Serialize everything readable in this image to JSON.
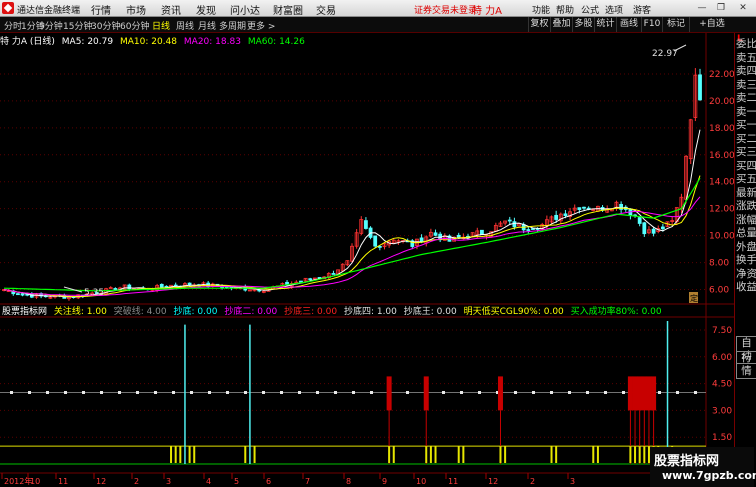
{
  "app": {
    "brand": "通达信金融终端"
  },
  "menu": [
    "行情",
    "市场",
    "资讯",
    "发现",
    "问小达",
    "财富圈",
    "交易"
  ],
  "warning": "证券交易未登录",
  "stock_title": "特 力A",
  "menu_right": [
    "功能",
    "帮助",
    "公式",
    "选项",
    "游客"
  ],
  "periods": [
    {
      "label": "分时",
      "active": false
    },
    {
      "label": "1分钟",
      "active": false
    },
    {
      "label": "5分钟",
      "active": false
    },
    {
      "label": "15分钟",
      "active": false
    },
    {
      "label": "30分钟",
      "active": false
    },
    {
      "label": "60分钟",
      "active": false
    },
    {
      "label": "日线",
      "active": true
    },
    {
      "label": "周线",
      "active": false
    },
    {
      "label": "月线",
      "active": false
    },
    {
      "label": "多周期",
      "active": false
    },
    {
      "label": "更多 >",
      "active": false
    }
  ],
  "toolbar_right": [
    "复权",
    "叠加",
    "多股",
    "统计",
    "画线",
    "F10",
    "标记",
    "+自选"
  ],
  "info": {
    "name": "特 力A (日线)",
    "ma": [
      {
        "label": "MA5: 20.79",
        "color": "#ffffff"
      },
      {
        "label": "MA10: 20.48",
        "color": "#ffff00"
      },
      {
        "label": "MA20: 18.83",
        "color": "#ff00ff"
      },
      {
        "label": "MA60: 14.26",
        "color": "#00ff00"
      }
    ]
  },
  "indicator": {
    "name": "股票指标网",
    "items": [
      {
        "label": "关注线: 1.00",
        "color": "#ffff00"
      },
      {
        "label": "突破线: 4.00",
        "color": "#888888"
      },
      {
        "label": "抄底: 0.00",
        "color": "#00ffff"
      },
      {
        "label": "抄底二: 0.00",
        "color": "#ff00ff"
      },
      {
        "label": "抄底三: 0.00",
        "color": "#ff2020"
      },
      {
        "label": "抄底四: 1.00",
        "color": "#e0e0e0"
      },
      {
        "label": "抄底王: 0.00",
        "color": "#e0e0e0"
      },
      {
        "label": "明天低买CGL90%: 0.00",
        "color": "#ffff00"
      },
      {
        "label": "买入成功率80%: 0.00",
        "color": "#00ff00"
      }
    ]
  },
  "right_panel": [
    "委比",
    "卖五",
    "卖四",
    "卖三",
    "卖二",
    "卖一",
    "买一",
    "买二",
    "买三",
    "买四",
    "买五",
    "最新",
    "涨跌",
    "涨幅",
    "总量",
    "外盘",
    "换手",
    "净资",
    "收益",
    "自动",
    "行情"
  ],
  "price_axis": [
    "22.00",
    "20.00",
    "18.00",
    "16.00",
    "14.00",
    "12.00",
    "10.00",
    "8.00",
    "6.00"
  ],
  "ind_axis": [
    "7.50",
    "6.00",
    "4.50",
    "3.00",
    "1.50"
  ],
  "date_axis": [
    "2012年",
    "10",
    "11",
    "12",
    "2",
    "3",
    "4",
    "5",
    "6",
    "7",
    "8",
    "9",
    "10",
    "11",
    "12",
    "2",
    "3"
  ],
  "high_label": "22.97",
  "low_label": "5.35",
  "ding_label": "定",
  "watermark": {
    "line1": "股票指标网",
    "line2": "www.7gpzb.com"
  },
  "colors": {
    "ma5": "#ffffff",
    "ma10": "#ffff00",
    "ma20": "#ff00ff",
    "ma60": "#00ff00",
    "up": "#ff3232",
    "down": "#54ffff"
  },
  "chart_data": {
    "type": "candlestick",
    "title": "特 力A (日线)",
    "ylim": [
      5,
      24
    ],
    "close_trend": [
      [
        0,
        6.0
      ],
      [
        4,
        5.6
      ],
      [
        8,
        5.5
      ],
      [
        14,
        5.45
      ],
      [
        20,
        5.8
      ],
      [
        26,
        6.2
      ],
      [
        30,
        6.0
      ],
      [
        36,
        6.3
      ],
      [
        42,
        6.4
      ],
      [
        50,
        6.1
      ],
      [
        56,
        6.0
      ],
      [
        60,
        6.3
      ],
      [
        66,
        6.8
      ],
      [
        70,
        7.1
      ],
      [
        74,
        8.0
      ],
      [
        77,
        11.0
      ],
      [
        80,
        9.2
      ],
      [
        84,
        9.8
      ],
      [
        88,
        9.3
      ],
      [
        92,
        10.2
      ],
      [
        96,
        9.6
      ],
      [
        100,
        10.0
      ],
      [
        104,
        10.3
      ],
      [
        108,
        11.0
      ],
      [
        112,
        10.6
      ],
      [
        116,
        10.8
      ],
      [
        120,
        11.6
      ],
      [
        124,
        12.2
      ],
      [
        128,
        12.0
      ],
      [
        132,
        12.4
      ],
      [
        134,
        12.0
      ],
      [
        136,
        11.5
      ],
      [
        138,
        10.4
      ],
      [
        140,
        10.2
      ],
      [
        142,
        10.6
      ],
      [
        144,
        11.0
      ],
      [
        146,
        13.0
      ],
      [
        147,
        16.0
      ],
      [
        148,
        19.0
      ],
      [
        149,
        21.5
      ],
      [
        150,
        20.5
      ]
    ],
    "ma60_trend": [
      [
        0,
        6.1
      ],
      [
        20,
        5.9
      ],
      [
        40,
        6.1
      ],
      [
        56,
        6.1
      ],
      [
        66,
        6.6
      ],
      [
        76,
        7.4
      ],
      [
        90,
        8.6
      ],
      [
        104,
        9.5
      ],
      [
        120,
        10.6
      ],
      [
        132,
        11.6
      ],
      [
        140,
        11.3
      ],
      [
        146,
        12.0
      ],
      [
        150,
        14.26
      ]
    ],
    "ind_axis_ylim": [
      0,
      8
    ],
    "cyan_spikes": [
      {
        "bar": 39,
        "value": 7.8
      },
      {
        "bar": 53,
        "value": 7.8
      },
      {
        "bar": 143,
        "value": 8.0
      }
    ],
    "red_block_bars": [
      83,
      91,
      107,
      135,
      136,
      137,
      138,
      139,
      140
    ],
    "reference_line": 4.0
  }
}
